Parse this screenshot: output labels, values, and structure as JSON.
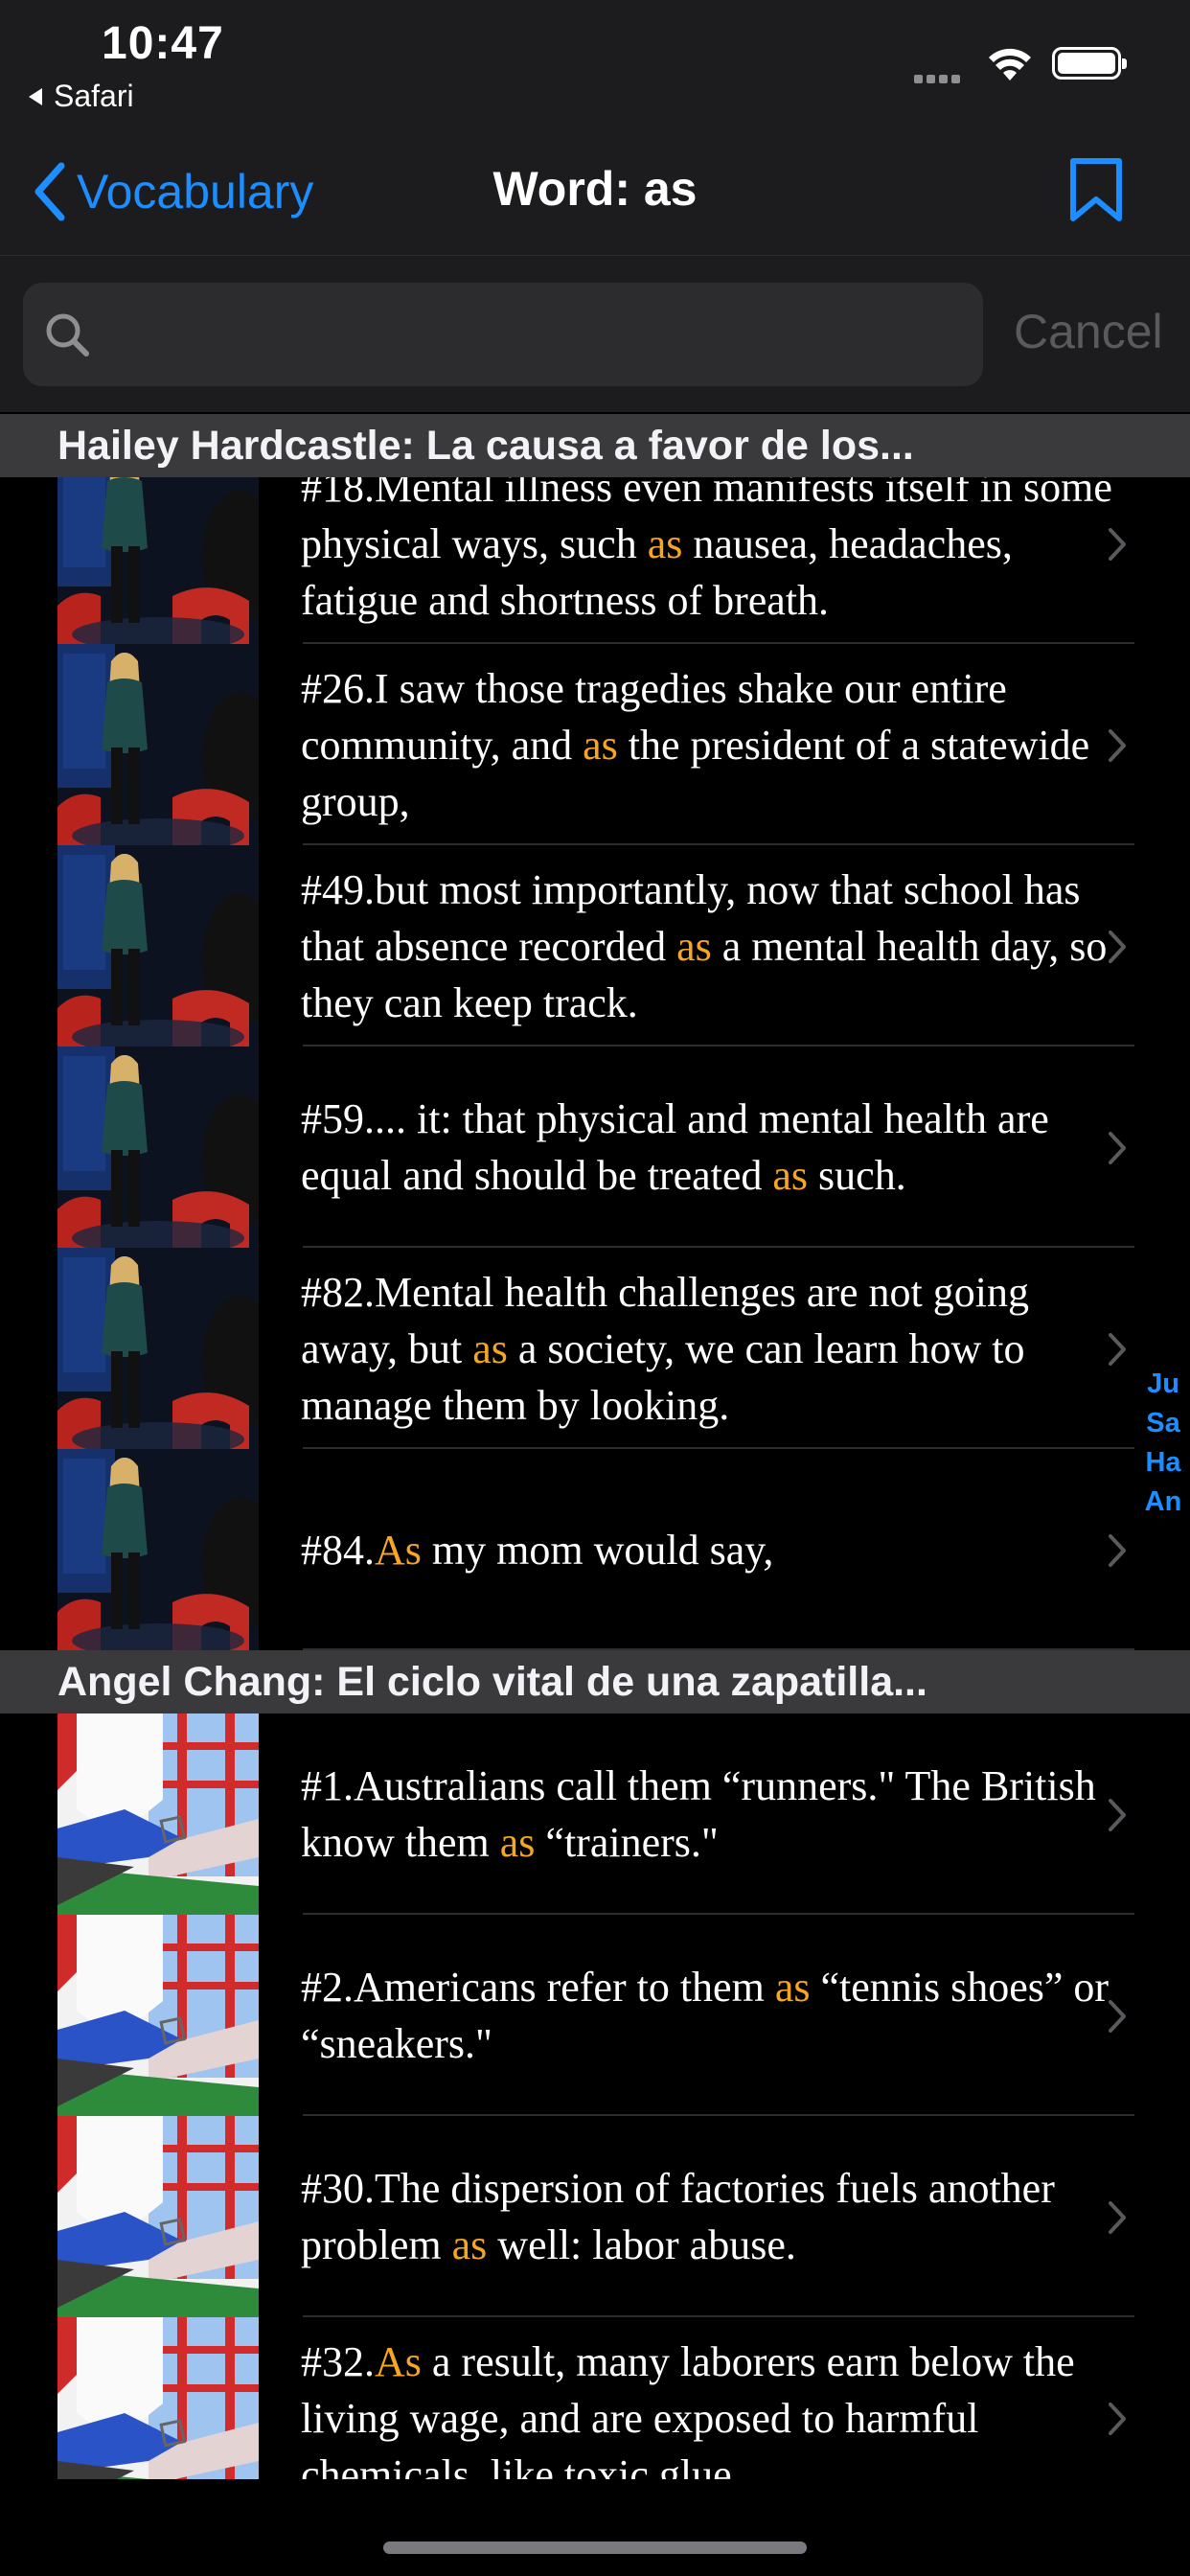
{
  "status": {
    "time": "10:47",
    "back_app": "Safari"
  },
  "nav": {
    "back_label": "Vocabulary",
    "title": "Word: as",
    "bookmark_icon": "bookmark-icon"
  },
  "search": {
    "placeholder": "",
    "cancel_label": "Cancel"
  },
  "highlight_color": "#f6a623",
  "accent_color": "#1c8eff",
  "sections": [
    {
      "title": "Hailey Hardcastle: La causa a favor de los...",
      "rows": [
        {
          "number": "#18.",
          "before": "Mental illness even manifests itself in some physical ways, such ",
          "word": "as",
          "after": " nausea, headaches, fatigue and shortness of breath."
        },
        {
          "number": "#26.",
          "before": "I saw those tragedies shake our entire community, and ",
          "word": "as",
          "after": " the president of a statewide group,"
        },
        {
          "number": "#49.",
          "before": "but most importantly, now that school has that absence recorded ",
          "word": "as",
          "after": " a mental health day, so they can keep track."
        },
        {
          "number": "#59.",
          "before": "... it: that physical and mental health are equal and should be treated ",
          "word": "as",
          "after": " such."
        },
        {
          "number": "#82.",
          "before": "Mental health challenges are not going away, but ",
          "word": "as",
          "after": " a society, we can learn how to manage them by looking."
        },
        {
          "number": "#84.",
          "before": "",
          "word": "As",
          "after": " my mom would say,"
        }
      ]
    },
    {
      "title": "Angel Chang: El ciclo vital de una zapatilla...",
      "rows": [
        {
          "number": "#1.",
          "before": "Australians call them “runners.\" The British know them ",
          "word": "as",
          "after": " “trainers.\""
        },
        {
          "number": "#2.",
          "before": "Americans refer to them ",
          "word": "as",
          "after": " “tennis shoes” or “sneakers.\""
        },
        {
          "number": "#30.",
          "before": "The dispersion of factories fuels another problem ",
          "word": "as",
          "after": " well: labor abuse."
        },
        {
          "number": "#32.",
          "before": "",
          "word": "As",
          "after": " a result, many laborers earn below the living wage, and are exposed to harmful chemicals, like toxic glue"
        }
      ]
    }
  ],
  "section_index": [
    "Ju",
    "Sa",
    "Ha",
    "An"
  ]
}
